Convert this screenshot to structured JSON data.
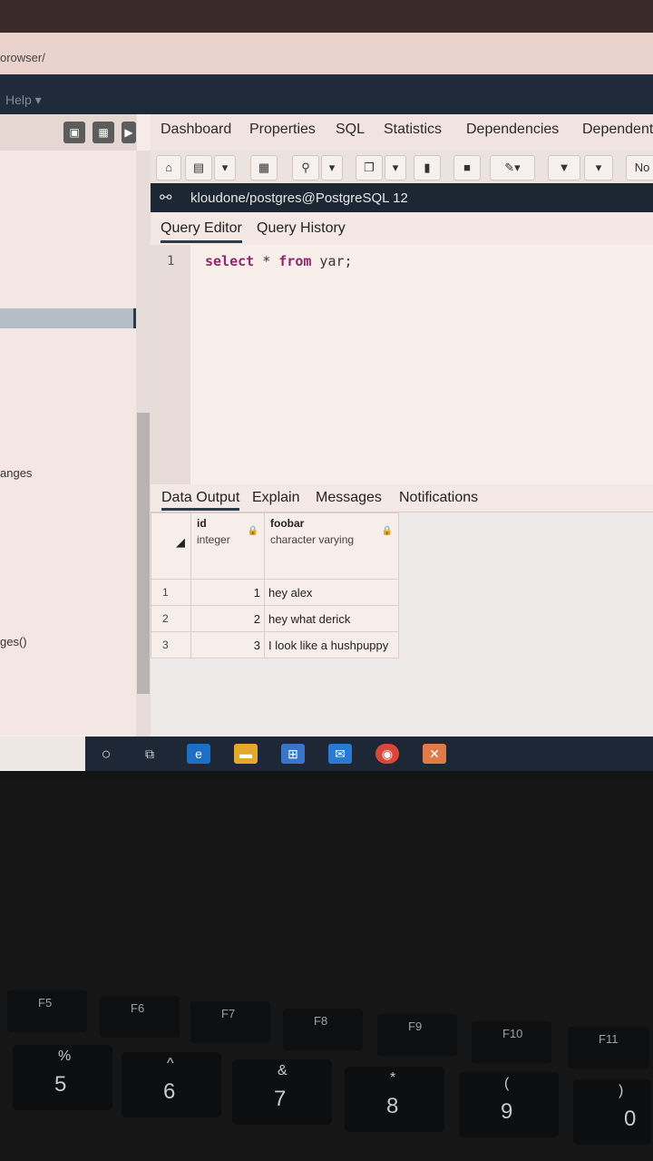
{
  "browser": {
    "url_fragment": "orowser/"
  },
  "menu": {
    "help_label": "Help ▾"
  },
  "main_tabs": [
    "Dashboard",
    "Properties",
    "SQL",
    "Statistics",
    "Dependencies",
    "Dependent"
  ],
  "toolbar": {
    "no_label": "No"
  },
  "connection": {
    "label": "kloudone/postgres@PostgreSQL 12"
  },
  "query_tabs": {
    "editor": "Query Editor",
    "history": "Query History"
  },
  "editor": {
    "line_number": "1",
    "keyword_select": "select",
    "star": " * ",
    "keyword_from": "from",
    "rest": " yar;"
  },
  "output_tabs": [
    "Data Output",
    "Explain",
    "Messages",
    "Notifications"
  ],
  "grid": {
    "columns": [
      {
        "name": "id",
        "type": "integer"
      },
      {
        "name": "foobar",
        "type": "character varying"
      }
    ],
    "rows": [
      {
        "rownum": "1",
        "id": "1",
        "foobar": "hey alex"
      },
      {
        "rownum": "2",
        "id": "2",
        "foobar": "hey what derick"
      },
      {
        "rownum": "3",
        "id": "3",
        "foobar": "I look like a hushpuppy"
      }
    ]
  },
  "left_panel": {
    "text_a": "anges",
    "text_b": "ges()"
  },
  "keyboard": {
    "fkeys": [
      "F5",
      "F6",
      "F7",
      "F8",
      "F9",
      "F10",
      "F11"
    ],
    "numkeys": [
      {
        "num": "5",
        "sym": "%"
      },
      {
        "num": "6",
        "sym": "^"
      },
      {
        "num": "7",
        "sym": "&"
      },
      {
        "num": "8",
        "sym": "*"
      },
      {
        "num": "9",
        "sym": "("
      },
      {
        "num": "0",
        "sym": ")"
      }
    ]
  }
}
